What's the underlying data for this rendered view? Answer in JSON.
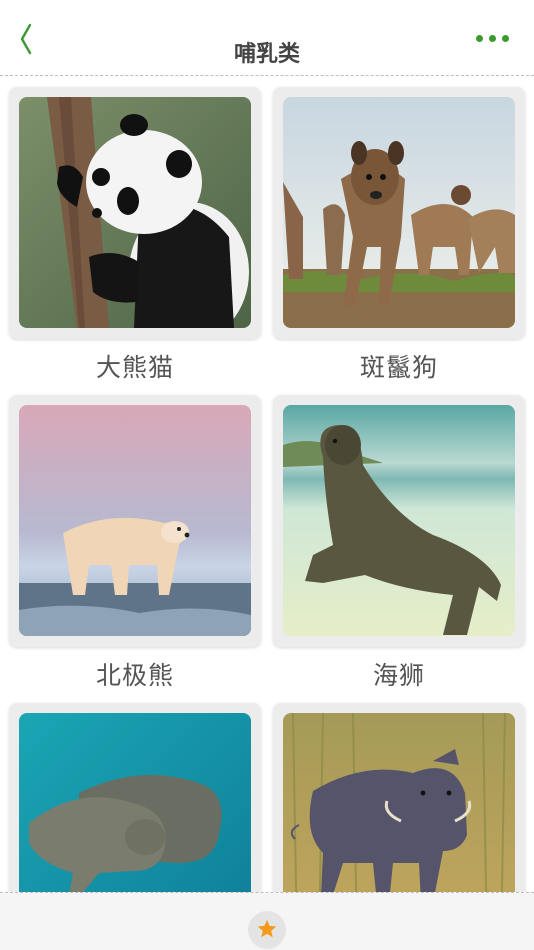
{
  "header": {
    "title": "哺乳类"
  },
  "animals": [
    {
      "name": "大熊猫"
    },
    {
      "name": "斑鬣狗"
    },
    {
      "name": "北极熊"
    },
    {
      "name": "海狮"
    },
    {
      "name": ""
    },
    {
      "name": ""
    }
  ],
  "colors": {
    "accent": "#3a9a2e",
    "star": "#f39a1e"
  },
  "icons": {
    "back": "chevron-left-icon",
    "more": "more-dots-icon",
    "favorite": "star-icon"
  }
}
